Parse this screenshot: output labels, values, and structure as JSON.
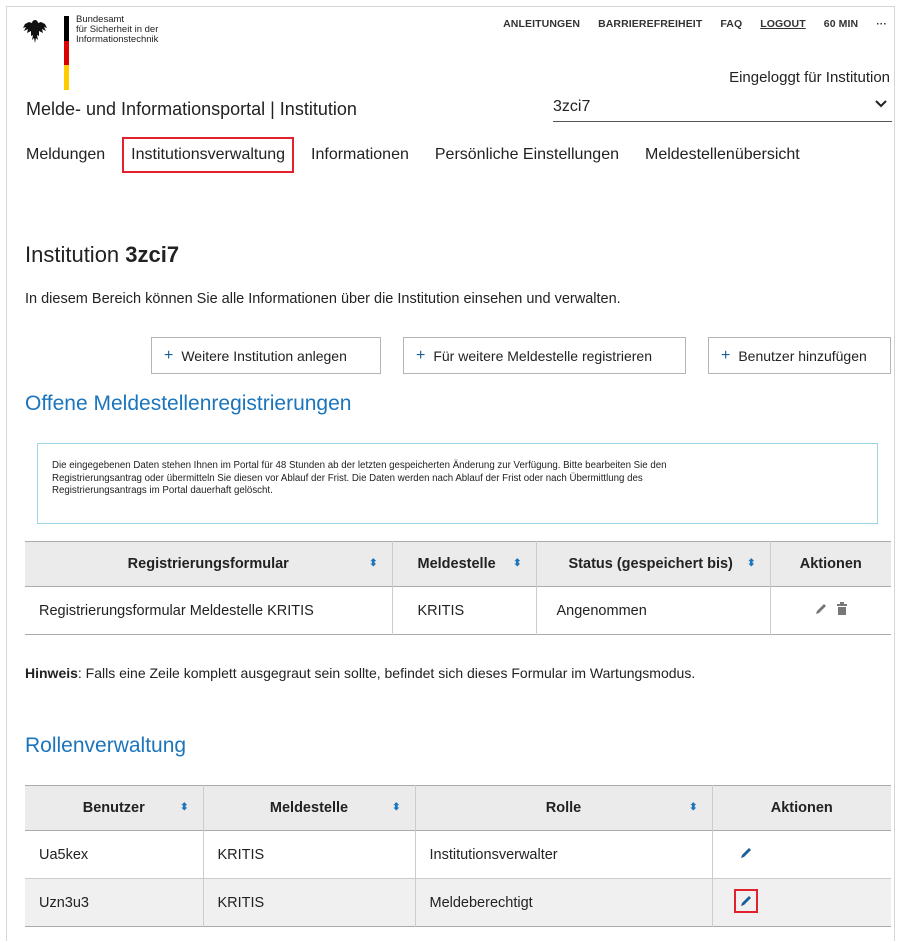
{
  "header": {
    "org_line1": "Bundesamt",
    "org_line2": "für Sicherheit in der",
    "org_line3": "Informationstechnik",
    "top_links": [
      "ANLEITUNGEN",
      "BARRIEREFREIHEIT",
      "FAQ",
      "LOGOUT",
      "60 MIN",
      "···"
    ],
    "logged_in": "Eingeloggt für Institution",
    "portal_title": "Melde- und Informationsportal | Institution",
    "institution_value": "3zci7"
  },
  "nav": {
    "items": [
      "Meldungen",
      "Institutionsverwaltung",
      "Informationen",
      "Persönliche Einstellungen",
      "Meldestellenübersicht"
    ]
  },
  "page": {
    "title_prefix": "Institution",
    "title_id": "3zci7",
    "intro": "In diesem Bereich können Sie alle Informationen über die Institution einsehen und verwalten.",
    "buttons": [
      "Weitere Institution anlegen",
      "Für weitere Meldestelle registrieren",
      "Benutzer hinzufügen"
    ]
  },
  "registrations": {
    "heading": "Offene Meldestellenregistrierungen",
    "info_line1": "Die eingegebenen Daten stehen Ihnen im Portal für 48 Stunden ab der letzten gespeicherten Änderung zur Verfügung. Bitte bearbeiten Sie den",
    "info_line2": "Registrierungsantrag oder übermitteln Sie diesen vor Ablauf der Frist. Die Daten werden nach Ablauf der Frist oder nach Übermittlung des",
    "info_line3": "Registrierungsantrags im Portal dauerhaft gelöscht.",
    "columns": [
      "Registrierungsformular",
      "Meldestelle",
      "Status (gespeichert bis)",
      "Aktionen"
    ],
    "rows": [
      {
        "form": "Registrierungsformular Meldestelle KRITIS",
        "meldestelle": "KRITIS",
        "status": "Angenommen"
      }
    ]
  },
  "hint": {
    "label": "Hinweis",
    "text": ": Falls eine Zeile komplett ausgegraut sein sollte, befindet sich dieses Formular im Wartungsmodus."
  },
  "roles": {
    "heading": "Rollenverwaltung",
    "columns": [
      "Benutzer",
      "Meldestelle",
      "Rolle",
      "Aktionen"
    ],
    "rows": [
      {
        "user": "Ua5kex",
        "meldestelle": "KRITIS",
        "role": "Institutionsverwalter"
      },
      {
        "user": "Uzn3u3",
        "meldestelle": "KRITIS",
        "role": "Meldeberechtigt"
      }
    ]
  },
  "colors": {
    "accent": "#1b75bc",
    "highlight": "#e3202d",
    "header_bg": "#ebebeb"
  }
}
